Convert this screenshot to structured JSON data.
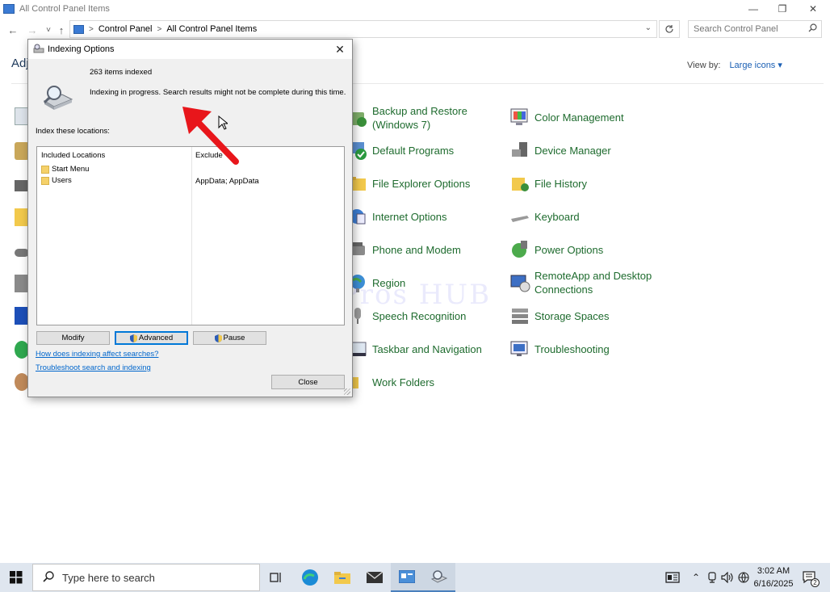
{
  "window": {
    "title": "All Control Panel Items",
    "minimize": "—",
    "restore": "❐",
    "close": "✕"
  },
  "nav": {
    "back": "←",
    "forward": "→",
    "recent": "˅",
    "up": "↑"
  },
  "address": {
    "crumbs": [
      "Control Panel",
      "All Control Panel Items"
    ],
    "separator": ">"
  },
  "search": {
    "placeholder": "Search Control Panel"
  },
  "main": {
    "heading": "Adj",
    "view_by_label": "View by:",
    "view_by_value": "Large icons ▾"
  },
  "cp_items": [
    {
      "label": "Backup and Restore (Windows 7)",
      "icon": "backup-restore-icon"
    },
    {
      "label": "Default Programs",
      "icon": "default-programs-icon"
    },
    {
      "label": "File Explorer Options",
      "icon": "folder-options-icon"
    },
    {
      "label": "Internet Options",
      "icon": "internet-options-icon"
    },
    {
      "label": "Phone and Modem",
      "icon": "phone-modem-icon"
    },
    {
      "label": "Region",
      "icon": "region-globe-icon"
    },
    {
      "label": "Speech Recognition",
      "icon": "microphone-icon"
    },
    {
      "label": "Taskbar and Navigation",
      "icon": "taskbar-icon"
    },
    {
      "label": "Work Folders",
      "icon": "work-folders-icon"
    },
    {
      "label": "Color Management",
      "icon": "color-management-icon"
    },
    {
      "label": "Device Manager",
      "icon": "device-manager-icon"
    },
    {
      "label": "File History",
      "icon": "file-history-icon"
    },
    {
      "label": "Keyboard",
      "icon": "keyboard-icon"
    },
    {
      "label": "Power Options",
      "icon": "power-options-icon"
    },
    {
      "label": "RemoteApp and Desktop Connections",
      "icon": "remoteapp-icon"
    },
    {
      "label": "Storage Spaces",
      "icon": "storage-spaces-icon"
    },
    {
      "label": "Troubleshooting",
      "icon": "troubleshooting-icon"
    }
  ],
  "dialog": {
    "title": "Indexing Options",
    "close": "✕",
    "items_indexed": "263 items indexed",
    "status": "Indexing in progress. Search results might not be complete during this time.",
    "locations_label": "Index these locations:",
    "col_included": "Included Locations",
    "col_exclude": "Exclude",
    "locations": [
      {
        "name": "Start Menu",
        "exclude": ""
      },
      {
        "name": "Users",
        "exclude": "AppData; AppData"
      }
    ],
    "btn_modify": "Modify",
    "btn_advanced": "Advanced",
    "btn_pause": "Pause",
    "link_affect": "How does indexing affect searches?",
    "link_troubleshoot": "Troubleshoot search and indexing",
    "btn_close": "Close"
  },
  "watermark": "IT Pros HUB",
  "taskbar": {
    "search_placeholder": "Type here to search",
    "time": "3:02 AM",
    "date": "6/16/2025",
    "notifications": "2"
  },
  "colors": {
    "cp_link": "#1e6b2e",
    "link_blue": "#0066cc",
    "accent": "#0078d7",
    "annotation_red": "#e8161b"
  }
}
